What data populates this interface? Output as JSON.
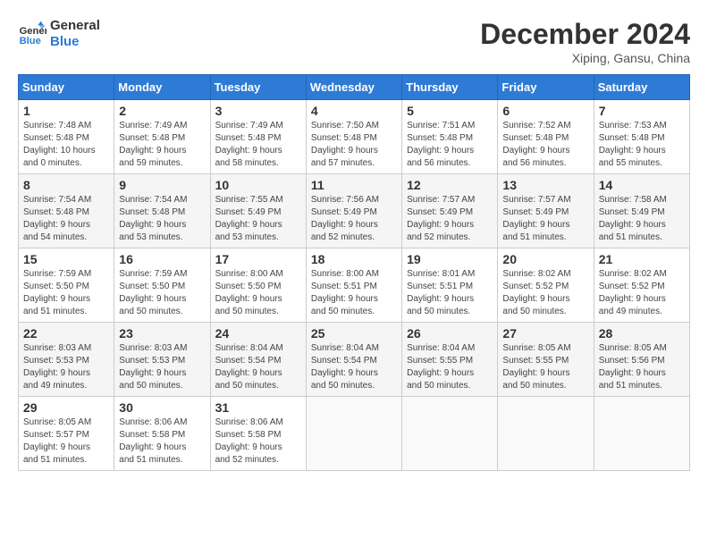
{
  "header": {
    "logo_line1": "General",
    "logo_line2": "Blue",
    "month_title": "December 2024",
    "location": "Xiping, Gansu, China"
  },
  "weekdays": [
    "Sunday",
    "Monday",
    "Tuesday",
    "Wednesday",
    "Thursday",
    "Friday",
    "Saturday"
  ],
  "weeks": [
    [
      {
        "day": "1",
        "info": "Sunrise: 7:48 AM\nSunset: 5:48 PM\nDaylight: 10 hours\nand 0 minutes."
      },
      {
        "day": "2",
        "info": "Sunrise: 7:49 AM\nSunset: 5:48 PM\nDaylight: 9 hours\nand 59 minutes."
      },
      {
        "day": "3",
        "info": "Sunrise: 7:49 AM\nSunset: 5:48 PM\nDaylight: 9 hours\nand 58 minutes."
      },
      {
        "day": "4",
        "info": "Sunrise: 7:50 AM\nSunset: 5:48 PM\nDaylight: 9 hours\nand 57 minutes."
      },
      {
        "day": "5",
        "info": "Sunrise: 7:51 AM\nSunset: 5:48 PM\nDaylight: 9 hours\nand 56 minutes."
      },
      {
        "day": "6",
        "info": "Sunrise: 7:52 AM\nSunset: 5:48 PM\nDaylight: 9 hours\nand 56 minutes."
      },
      {
        "day": "7",
        "info": "Sunrise: 7:53 AM\nSunset: 5:48 PM\nDaylight: 9 hours\nand 55 minutes."
      }
    ],
    [
      {
        "day": "8",
        "info": "Sunrise: 7:54 AM\nSunset: 5:48 PM\nDaylight: 9 hours\nand 54 minutes."
      },
      {
        "day": "9",
        "info": "Sunrise: 7:54 AM\nSunset: 5:48 PM\nDaylight: 9 hours\nand 53 minutes."
      },
      {
        "day": "10",
        "info": "Sunrise: 7:55 AM\nSunset: 5:49 PM\nDaylight: 9 hours\nand 53 minutes."
      },
      {
        "day": "11",
        "info": "Sunrise: 7:56 AM\nSunset: 5:49 PM\nDaylight: 9 hours\nand 52 minutes."
      },
      {
        "day": "12",
        "info": "Sunrise: 7:57 AM\nSunset: 5:49 PM\nDaylight: 9 hours\nand 52 minutes."
      },
      {
        "day": "13",
        "info": "Sunrise: 7:57 AM\nSunset: 5:49 PM\nDaylight: 9 hours\nand 51 minutes."
      },
      {
        "day": "14",
        "info": "Sunrise: 7:58 AM\nSunset: 5:49 PM\nDaylight: 9 hours\nand 51 minutes."
      }
    ],
    [
      {
        "day": "15",
        "info": "Sunrise: 7:59 AM\nSunset: 5:50 PM\nDaylight: 9 hours\nand 51 minutes."
      },
      {
        "day": "16",
        "info": "Sunrise: 7:59 AM\nSunset: 5:50 PM\nDaylight: 9 hours\nand 50 minutes."
      },
      {
        "day": "17",
        "info": "Sunrise: 8:00 AM\nSunset: 5:50 PM\nDaylight: 9 hours\nand 50 minutes."
      },
      {
        "day": "18",
        "info": "Sunrise: 8:00 AM\nSunset: 5:51 PM\nDaylight: 9 hours\nand 50 minutes."
      },
      {
        "day": "19",
        "info": "Sunrise: 8:01 AM\nSunset: 5:51 PM\nDaylight: 9 hours\nand 50 minutes."
      },
      {
        "day": "20",
        "info": "Sunrise: 8:02 AM\nSunset: 5:52 PM\nDaylight: 9 hours\nand 50 minutes."
      },
      {
        "day": "21",
        "info": "Sunrise: 8:02 AM\nSunset: 5:52 PM\nDaylight: 9 hours\nand 49 minutes."
      }
    ],
    [
      {
        "day": "22",
        "info": "Sunrise: 8:03 AM\nSunset: 5:53 PM\nDaylight: 9 hours\nand 49 minutes."
      },
      {
        "day": "23",
        "info": "Sunrise: 8:03 AM\nSunset: 5:53 PM\nDaylight: 9 hours\nand 50 minutes."
      },
      {
        "day": "24",
        "info": "Sunrise: 8:04 AM\nSunset: 5:54 PM\nDaylight: 9 hours\nand 50 minutes."
      },
      {
        "day": "25",
        "info": "Sunrise: 8:04 AM\nSunset: 5:54 PM\nDaylight: 9 hours\nand 50 minutes."
      },
      {
        "day": "26",
        "info": "Sunrise: 8:04 AM\nSunset: 5:55 PM\nDaylight: 9 hours\nand 50 minutes."
      },
      {
        "day": "27",
        "info": "Sunrise: 8:05 AM\nSunset: 5:55 PM\nDaylight: 9 hours\nand 50 minutes."
      },
      {
        "day": "28",
        "info": "Sunrise: 8:05 AM\nSunset: 5:56 PM\nDaylight: 9 hours\nand 51 minutes."
      }
    ],
    [
      {
        "day": "29",
        "info": "Sunrise: 8:05 AM\nSunset: 5:57 PM\nDaylight: 9 hours\nand 51 minutes."
      },
      {
        "day": "30",
        "info": "Sunrise: 8:06 AM\nSunset: 5:58 PM\nDaylight: 9 hours\nand 51 minutes."
      },
      {
        "day": "31",
        "info": "Sunrise: 8:06 AM\nSunset: 5:58 PM\nDaylight: 9 hours\nand 52 minutes."
      },
      {
        "day": "",
        "info": ""
      },
      {
        "day": "",
        "info": ""
      },
      {
        "day": "",
        "info": ""
      },
      {
        "day": "",
        "info": ""
      }
    ]
  ]
}
